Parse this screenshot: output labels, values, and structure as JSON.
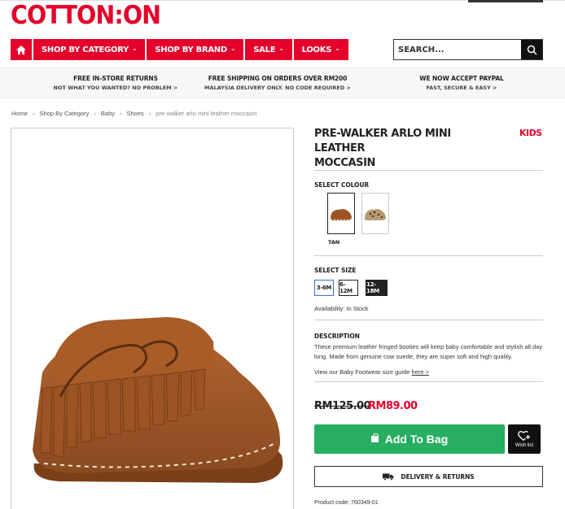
{
  "brand": {
    "logo": "COTTON:ON",
    "accent": "#e4002b"
  },
  "nav": {
    "home_icon": "home-icon",
    "items": [
      {
        "label": "SHOP BY CATEGORY"
      },
      {
        "label": "SHOP BY BRAND"
      },
      {
        "label": "SALE"
      },
      {
        "label": "LOOKS"
      }
    ]
  },
  "search": {
    "placeholder": "SEARCH...",
    "icon": "search-icon"
  },
  "promos": [
    {
      "title": "FREE IN-STORE RETURNS",
      "sub": "NOT WHAT YOU WANTED? NO PROBLEM >"
    },
    {
      "title": "FREE SHIPPING ON ORDERS OVER RM200",
      "sub": "MALAYSIA DELIVERY ONLY. NO CODE REQUIRED >"
    },
    {
      "title": "WE NOW ACCEPT PAYPAL",
      "sub": "FAST, SECURE & EASY >"
    }
  ],
  "breadcrumb": [
    "Home",
    "Shop By Category",
    "Baby",
    "Shoes",
    "pre-walker arlo mini leather moccasin"
  ],
  "product": {
    "title_line1": "PRE-WALKER ARLO MINI LEATHER",
    "title_line2": "MOCCASIN",
    "badge": "KIDS",
    "select_colour_label": "SELECT COLOUR",
    "selected_colour": "TAN",
    "select_size_label": "SELECT SIZE",
    "sizes": [
      "3-6M",
      "6-12M",
      "12-18M"
    ],
    "availability": "Availability: In Stock",
    "description_label": "DESCRIPTION",
    "description": "These premium leather fringed booties will keep baby comfortable and stylish all day long. Made from genuine cow suede, they are super soft and high quality.",
    "size_guide_text": "View our Baby Footwear size guide",
    "size_guide_link": "here >",
    "price_old": "RM125.00",
    "price_new": "RM89.00",
    "add_to_bag": "Add To Bag",
    "wishlist": "Wish list",
    "delivery": "DELIVERY & RETURNS",
    "product_code": "Product code: 760349-01"
  },
  "colors": {
    "green": "#27ae60",
    "red": "#e4002b"
  }
}
